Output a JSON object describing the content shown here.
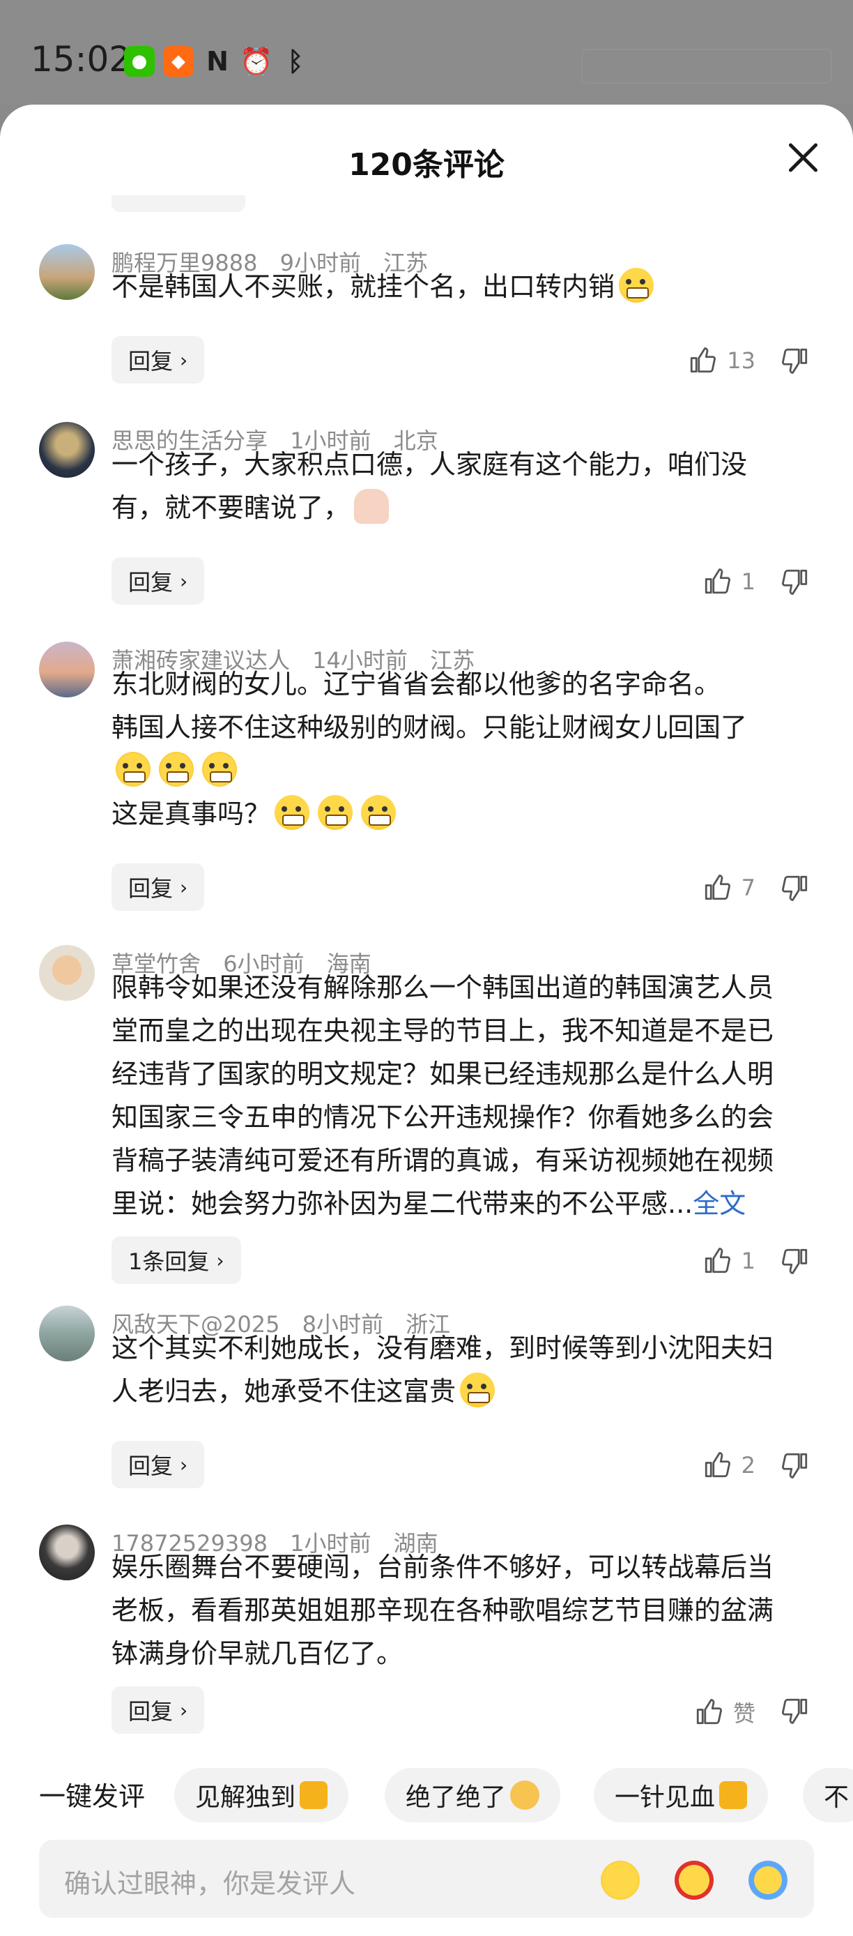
{
  "status_bar": {
    "time": "15:02",
    "icons": [
      "wechat-icon",
      "app-icon",
      "nfc-icon",
      "alarm-icon",
      "bluetooth-icon"
    ]
  },
  "sheet": {
    "title": "120条评论"
  },
  "comments": [
    {
      "user": "鹏程万里9888",
      "time": "9小时前",
      "location": "江苏",
      "lines": [
        "不是韩国人不买账，就挂个名，出口转内销"
      ],
      "reply_label": "回复",
      "likes": "13"
    },
    {
      "user": "思思的生活分享",
      "time": "1小时前",
      "location": "北京",
      "lines": [
        "一个孩子，大家积点口德，人家庭有这个能力，咱们没",
        "有，就不要瞎说了，"
      ],
      "reply_label": "回复",
      "likes": "1"
    },
    {
      "user": "萧湘砖家建议达人",
      "time": "14小时前",
      "location": "江苏",
      "lines": [
        "东北财阀的女儿。辽宁省省会都以他爹的名字命名。",
        "韩国人接不住这种级别的财阀。只能让财阀女儿回国了",
        "",
        "这是真事吗？"
      ],
      "reply_label": "回复",
      "likes": "7"
    },
    {
      "user": "草堂竹舍",
      "time": "6小时前",
      "location": "海南",
      "lines": [
        "限韩令如果还没有解除那么一个韩国出道的韩国演艺人员",
        "堂而皇之的出现在央视主导的节目上，我不知道是不是已",
        "经违背了国家的明文规定？如果已经违规那么是什么人明",
        "知国家三令五申的情况下公开违规操作？你看她多么的会",
        "背稿子装清纯可爱还有所谓的真诚，有采访视频她在视频",
        "里说：她会努力弥补因为星二代带来的不公平感..."
      ],
      "more_label": "全文",
      "reply_label": "1条回复",
      "likes": "1"
    },
    {
      "user": "风敌天下@2025",
      "time": "8小时前",
      "location": "浙江",
      "lines": [
        "这个其实不利她成长，没有磨难，到时候等到小沈阳夫妇",
        "人老归去，她承受不住这富贵"
      ],
      "reply_label": "回复",
      "likes": "2"
    },
    {
      "user": "17872529398",
      "time": "1小时前",
      "location": "湖南",
      "lines": [
        "娱乐圈舞台不要硬闯，台前条件不够好，可以转战幕后当",
        "老板，看看那英姐姐那辛现在各种歌唱综艺节目赚的盆满",
        "钵满身价早就几百亿了。"
      ],
      "reply_label": "回复",
      "likes": "赞"
    }
  ],
  "quick_reply": {
    "label": "一键发评",
    "chips": [
      "见解独到",
      "绝了绝了",
      "一针见血",
      "不"
    ]
  },
  "input": {
    "placeholder": "确认过眼神，你是发评人"
  }
}
